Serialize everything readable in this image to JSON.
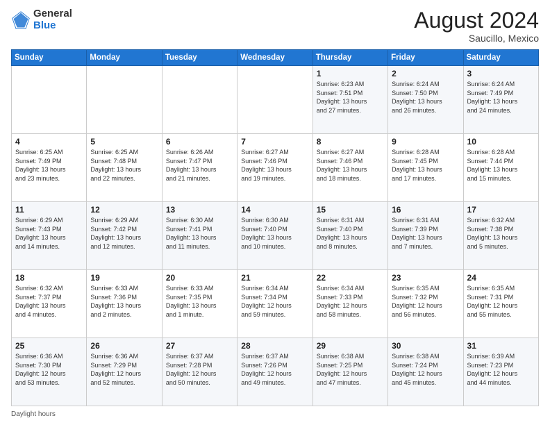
{
  "logo": {
    "general": "General",
    "blue": "Blue"
  },
  "header": {
    "month_year": "August 2024",
    "location": "Saucillo, Mexico"
  },
  "footer": {
    "daylight_label": "Daylight hours"
  },
  "weekdays": [
    "Sunday",
    "Monday",
    "Tuesday",
    "Wednesday",
    "Thursday",
    "Friday",
    "Saturday"
  ],
  "weeks": [
    [
      {
        "day": "",
        "detail": ""
      },
      {
        "day": "",
        "detail": ""
      },
      {
        "day": "",
        "detail": ""
      },
      {
        "day": "",
        "detail": ""
      },
      {
        "day": "1",
        "detail": "Sunrise: 6:23 AM\nSunset: 7:51 PM\nDaylight: 13 hours\nand 27 minutes."
      },
      {
        "day": "2",
        "detail": "Sunrise: 6:24 AM\nSunset: 7:50 PM\nDaylight: 13 hours\nand 26 minutes."
      },
      {
        "day": "3",
        "detail": "Sunrise: 6:24 AM\nSunset: 7:49 PM\nDaylight: 13 hours\nand 24 minutes."
      }
    ],
    [
      {
        "day": "4",
        "detail": "Sunrise: 6:25 AM\nSunset: 7:49 PM\nDaylight: 13 hours\nand 23 minutes."
      },
      {
        "day": "5",
        "detail": "Sunrise: 6:25 AM\nSunset: 7:48 PM\nDaylight: 13 hours\nand 22 minutes."
      },
      {
        "day": "6",
        "detail": "Sunrise: 6:26 AM\nSunset: 7:47 PM\nDaylight: 13 hours\nand 21 minutes."
      },
      {
        "day": "7",
        "detail": "Sunrise: 6:27 AM\nSunset: 7:46 PM\nDaylight: 13 hours\nand 19 minutes."
      },
      {
        "day": "8",
        "detail": "Sunrise: 6:27 AM\nSunset: 7:46 PM\nDaylight: 13 hours\nand 18 minutes."
      },
      {
        "day": "9",
        "detail": "Sunrise: 6:28 AM\nSunset: 7:45 PM\nDaylight: 13 hours\nand 17 minutes."
      },
      {
        "day": "10",
        "detail": "Sunrise: 6:28 AM\nSunset: 7:44 PM\nDaylight: 13 hours\nand 15 minutes."
      }
    ],
    [
      {
        "day": "11",
        "detail": "Sunrise: 6:29 AM\nSunset: 7:43 PM\nDaylight: 13 hours\nand 14 minutes."
      },
      {
        "day": "12",
        "detail": "Sunrise: 6:29 AM\nSunset: 7:42 PM\nDaylight: 13 hours\nand 12 minutes."
      },
      {
        "day": "13",
        "detail": "Sunrise: 6:30 AM\nSunset: 7:41 PM\nDaylight: 13 hours\nand 11 minutes."
      },
      {
        "day": "14",
        "detail": "Sunrise: 6:30 AM\nSunset: 7:40 PM\nDaylight: 13 hours\nand 10 minutes."
      },
      {
        "day": "15",
        "detail": "Sunrise: 6:31 AM\nSunset: 7:40 PM\nDaylight: 13 hours\nand 8 minutes."
      },
      {
        "day": "16",
        "detail": "Sunrise: 6:31 AM\nSunset: 7:39 PM\nDaylight: 13 hours\nand 7 minutes."
      },
      {
        "day": "17",
        "detail": "Sunrise: 6:32 AM\nSunset: 7:38 PM\nDaylight: 13 hours\nand 5 minutes."
      }
    ],
    [
      {
        "day": "18",
        "detail": "Sunrise: 6:32 AM\nSunset: 7:37 PM\nDaylight: 13 hours\nand 4 minutes."
      },
      {
        "day": "19",
        "detail": "Sunrise: 6:33 AM\nSunset: 7:36 PM\nDaylight: 13 hours\nand 2 minutes."
      },
      {
        "day": "20",
        "detail": "Sunrise: 6:33 AM\nSunset: 7:35 PM\nDaylight: 13 hours\nand 1 minute."
      },
      {
        "day": "21",
        "detail": "Sunrise: 6:34 AM\nSunset: 7:34 PM\nDaylight: 12 hours\nand 59 minutes."
      },
      {
        "day": "22",
        "detail": "Sunrise: 6:34 AM\nSunset: 7:33 PM\nDaylight: 12 hours\nand 58 minutes."
      },
      {
        "day": "23",
        "detail": "Sunrise: 6:35 AM\nSunset: 7:32 PM\nDaylight: 12 hours\nand 56 minutes."
      },
      {
        "day": "24",
        "detail": "Sunrise: 6:35 AM\nSunset: 7:31 PM\nDaylight: 12 hours\nand 55 minutes."
      }
    ],
    [
      {
        "day": "25",
        "detail": "Sunrise: 6:36 AM\nSunset: 7:30 PM\nDaylight: 12 hours\nand 53 minutes."
      },
      {
        "day": "26",
        "detail": "Sunrise: 6:36 AM\nSunset: 7:29 PM\nDaylight: 12 hours\nand 52 minutes."
      },
      {
        "day": "27",
        "detail": "Sunrise: 6:37 AM\nSunset: 7:28 PM\nDaylight: 12 hours\nand 50 minutes."
      },
      {
        "day": "28",
        "detail": "Sunrise: 6:37 AM\nSunset: 7:26 PM\nDaylight: 12 hours\nand 49 minutes."
      },
      {
        "day": "29",
        "detail": "Sunrise: 6:38 AM\nSunset: 7:25 PM\nDaylight: 12 hours\nand 47 minutes."
      },
      {
        "day": "30",
        "detail": "Sunrise: 6:38 AM\nSunset: 7:24 PM\nDaylight: 12 hours\nand 45 minutes."
      },
      {
        "day": "31",
        "detail": "Sunrise: 6:39 AM\nSunset: 7:23 PM\nDaylight: 12 hours\nand 44 minutes."
      }
    ]
  ]
}
